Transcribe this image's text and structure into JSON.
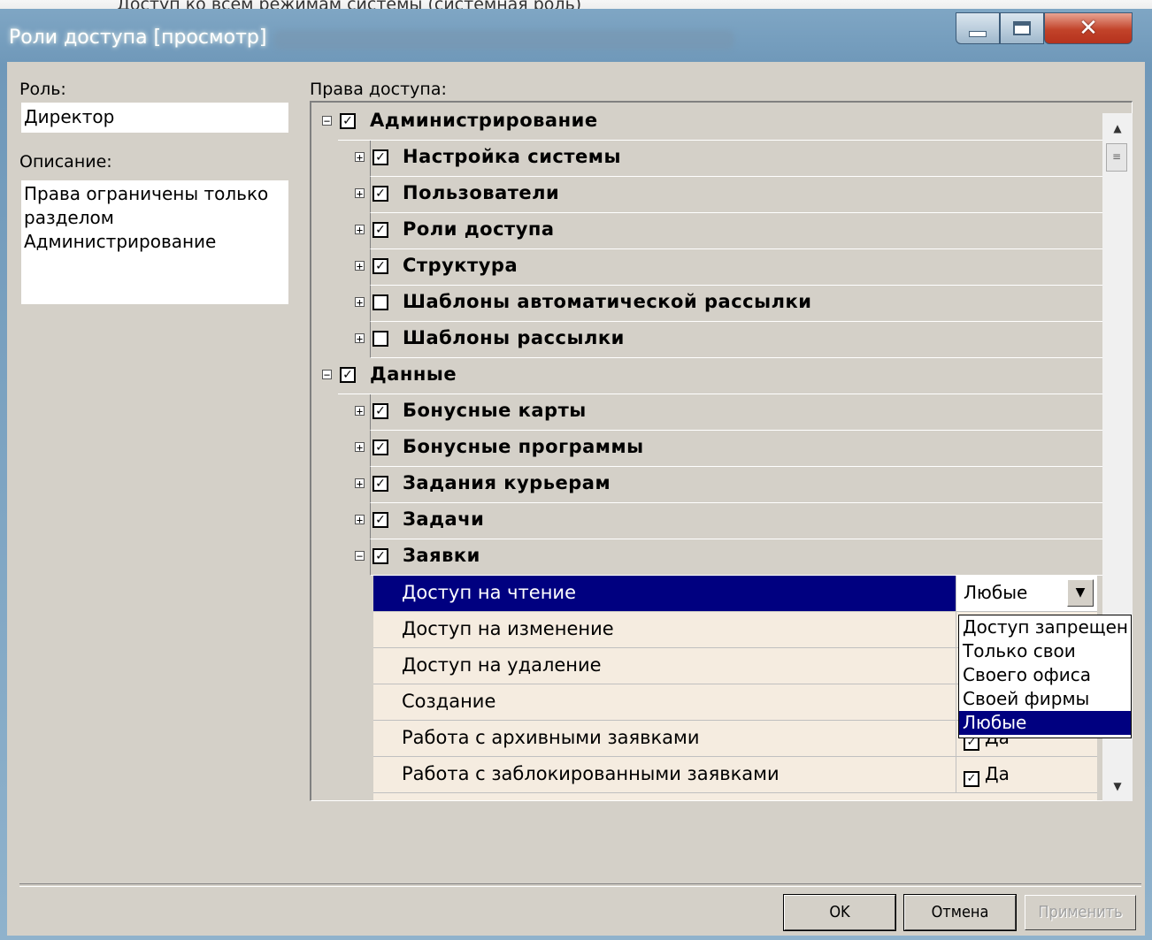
{
  "background": {
    "text": "Доступ ко всем режимам системы (системная роль)"
  },
  "window": {
    "title": "Роли доступа [просмотр]"
  },
  "role": {
    "label": "Роль:",
    "value": "Директор"
  },
  "description": {
    "label": "Описание:",
    "value": "Права ограничены только\nразделом\nАдминистрирование"
  },
  "rights": {
    "label": "Права доступа:",
    "tree": [
      {
        "name": "Администрирование",
        "level": 0,
        "expanded": true,
        "checked": true
      },
      {
        "name": "Настройка системы",
        "level": 1,
        "expanded": false,
        "checked": true
      },
      {
        "name": "Пользователи",
        "level": 1,
        "expanded": false,
        "checked": true
      },
      {
        "name": "Роли доступа",
        "level": 1,
        "expanded": false,
        "checked": true
      },
      {
        "name": "Структура",
        "level": 1,
        "expanded": false,
        "checked": true
      },
      {
        "name": "Шаблоны автоматической рассылки",
        "level": 1,
        "expanded": false,
        "checked": false
      },
      {
        "name": "Шаблоны рассылки",
        "level": 1,
        "expanded": false,
        "checked": false
      },
      {
        "name": "Данные",
        "level": 0,
        "expanded": true,
        "checked": true
      },
      {
        "name": "Бонусные карты",
        "level": 1,
        "expanded": false,
        "checked": true
      },
      {
        "name": "Бонусные программы",
        "level": 1,
        "expanded": false,
        "checked": true
      },
      {
        "name": "Задания курьерам",
        "level": 1,
        "expanded": false,
        "checked": true
      },
      {
        "name": "Задачи",
        "level": 1,
        "expanded": false,
        "checked": true
      },
      {
        "name": "Заявки",
        "level": 1,
        "expanded": true,
        "checked": true
      }
    ],
    "properties": [
      {
        "name": "Доступ на чтение",
        "value": "Любые",
        "selected": true
      },
      {
        "name": "Доступ на изменение",
        "value": ""
      },
      {
        "name": "Доступ на удаление",
        "value": ""
      },
      {
        "name": "Создание",
        "value": ""
      },
      {
        "name": "Работа с архивными заявками",
        "value": "Да",
        "checked": true
      },
      {
        "name": "Работа с заблокированными заявками",
        "value": "Да",
        "checked": true
      }
    ]
  },
  "dropdown": {
    "options": [
      "Доступ запрещен",
      "Только свои",
      "Своего офиса",
      "Своей фирмы",
      "Любые"
    ],
    "selected": "Любые"
  },
  "buttons": {
    "ok": "OK",
    "cancel": "Отмена",
    "apply": "Применить"
  },
  "colors": {
    "selection": "#000080",
    "panel": "#d4d0c8",
    "property_bg": "#f5ece0"
  }
}
